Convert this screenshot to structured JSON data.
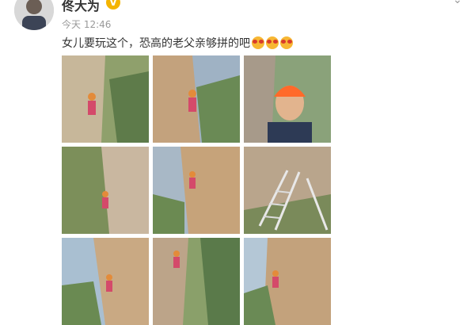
{
  "post": {
    "username": "佟大为",
    "verified_badge": "V",
    "menu_icon": "chevron-down-icon",
    "timestamp": "今天 12:46",
    "text": "女儿要玩这个，恐高的老父亲够拼的吧",
    "emoji_count": 3,
    "emoji_icon": "scared-face-emoji"
  },
  "photos": [
    {
      "subject": "climber-on-cliff"
    },
    {
      "subject": "climber-on-cliff"
    },
    {
      "subject": "selfie-helmet"
    },
    {
      "subject": "climber-on-cliff"
    },
    {
      "subject": "climber-on-cliff"
    },
    {
      "subject": "via-ferrata-ladder"
    },
    {
      "subject": "climber-on-cliff"
    },
    {
      "subject": "climber-on-cliff"
    },
    {
      "subject": "climber-on-cliff"
    }
  ]
}
